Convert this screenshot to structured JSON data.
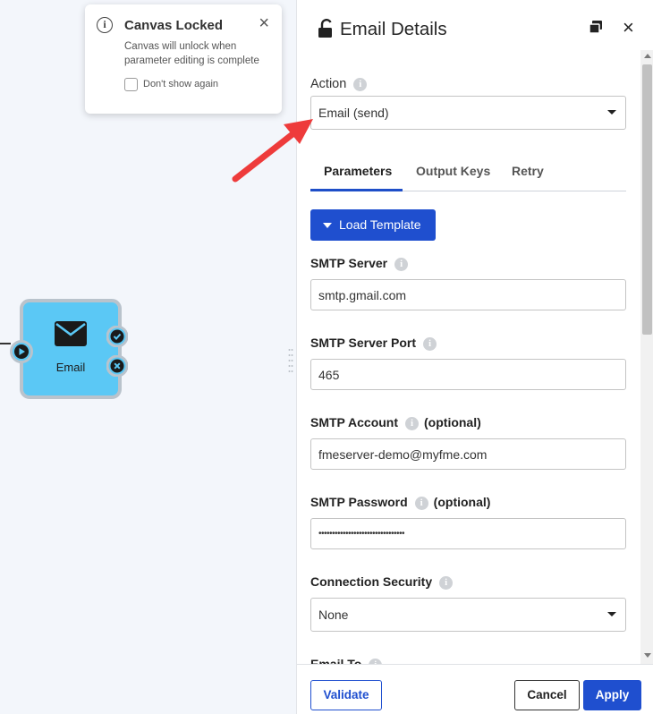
{
  "toast": {
    "title": "Canvas Locked",
    "body": "Canvas will unlock when parameter editing is complete",
    "checkbox_label": "Don't show again",
    "close": "×"
  },
  "node": {
    "label": "Email",
    "color": "#5bc8f5"
  },
  "panel": {
    "title": "Email Details",
    "close": "×",
    "action_label": "Action",
    "action_value": "Email (send)",
    "tabs": [
      {
        "label": "Parameters"
      },
      {
        "label": "Output Keys"
      },
      {
        "label": "Retry"
      }
    ],
    "load_template_label": "Load Template",
    "fields": {
      "smtp_server": {
        "label": "SMTP Server",
        "value": "smtp.gmail.com"
      },
      "smtp_port": {
        "label": "SMTP Server Port",
        "value": "465"
      },
      "smtp_account": {
        "label": "SMTP Account",
        "optional": "(optional)",
        "value": "fmeserver-demo@myfme.com"
      },
      "smtp_password": {
        "label": "SMTP Password",
        "optional": "(optional)",
        "value": "••••••••••••••••••••••••••••••••"
      },
      "connection_security": {
        "label": "Connection Security",
        "value": "None"
      },
      "email_to": {
        "label": "Email To"
      }
    },
    "footer": {
      "validate": "Validate",
      "cancel": "Cancel",
      "apply": "Apply"
    }
  },
  "colors": {
    "accent": "#1f4fcf",
    "annotation_arrow": "#ee3b3b"
  }
}
